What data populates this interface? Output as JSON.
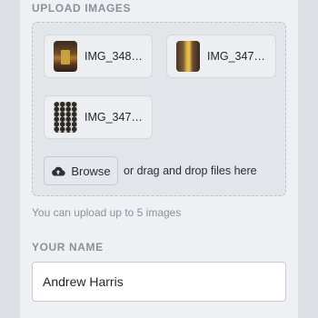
{
  "upload": {
    "section_label": "UPLOAD IMAGES",
    "files": [
      {
        "name": "IMG_348…",
        "thumb": "jar-photo-thumbnail"
      },
      {
        "name": "IMG_347…",
        "thumb": "hallway-photo-thumbnail"
      },
      {
        "name": "IMG_347…",
        "thumb": "tile-pattern-thumbnail"
      }
    ],
    "browse_label": "Browse",
    "browse_icon": "cloud-upload-icon",
    "drag_text": "or drag and drop files here",
    "hint": "You can upload up to 5 images"
  },
  "name": {
    "section_label": "YOUR NAME",
    "value": "Andrew Harris"
  },
  "colors": {
    "background": "#eef0f3",
    "drop_zone": "#e2e5ea",
    "label_gray": "#8a919b"
  }
}
